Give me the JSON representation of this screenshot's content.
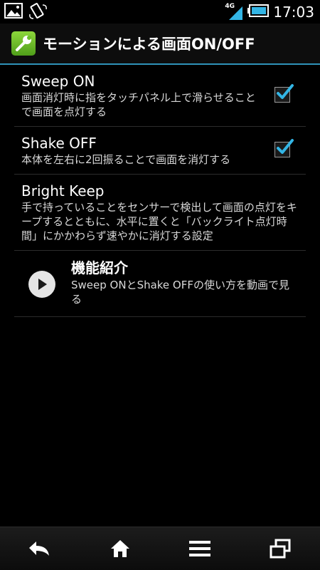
{
  "status_bar": {
    "network_label": "4G",
    "time": "17:03",
    "icons": [
      "image-notification-icon",
      "screen-rotation-icon",
      "signal-icon",
      "battery-icon"
    ]
  },
  "action_bar": {
    "app_icon": "wrench-icon",
    "title": "モーションによる画面ON/OFF"
  },
  "settings": [
    {
      "title": "Sweep ON",
      "summary": "画面消灯時に指をタッチパネル上で滑らせることで画面を点灯する",
      "checked": true
    },
    {
      "title": "Shake OFF",
      "summary": "本体を左右に2回振ることで画面を消灯する",
      "checked": true
    },
    {
      "title": "Bright Keep",
      "summary": "手で持っていることをセンサーで検出して画面の点灯をキープするとともに、水平に置くと「バックライト点灯時間」にかかわらず速やかに消灯する設定"
    }
  ],
  "video_item": {
    "icon": "play-icon",
    "title": "機能紹介",
    "summary": "Sweep ONとShake OFFの使い方を動画で見る"
  },
  "nav_bar": {
    "buttons": [
      "back-icon",
      "home-icon",
      "menu-icon",
      "recent-apps-icon"
    ]
  },
  "colors": {
    "accent": "#2f92b8",
    "checkmark": "#33b5e5",
    "background": "#000000"
  }
}
